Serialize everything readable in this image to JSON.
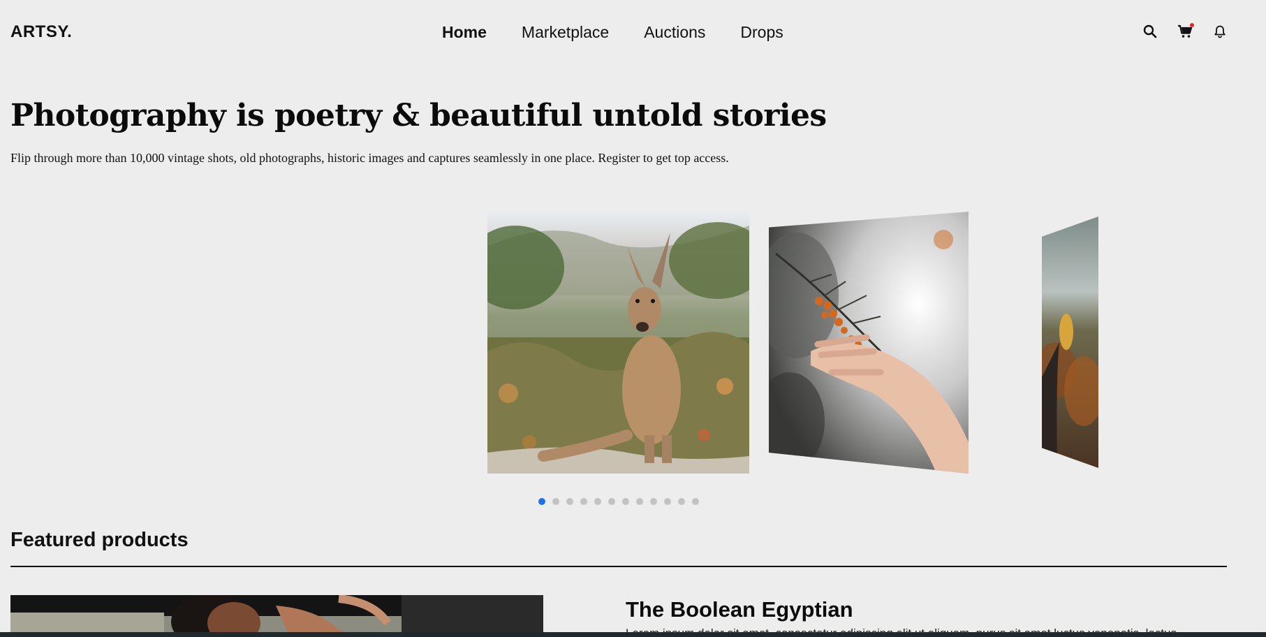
{
  "brand": {
    "logo": "ARTSY."
  },
  "nav": {
    "items": [
      {
        "label": "Home",
        "active": true
      },
      {
        "label": "Marketplace",
        "active": false
      },
      {
        "label": "Auctions",
        "active": false
      },
      {
        "label": "Drops",
        "active": false
      }
    ]
  },
  "header_icons": [
    {
      "name": "search-icon"
    },
    {
      "name": "cart-icon",
      "has_notification_dot": true
    },
    {
      "name": "bell-icon"
    }
  ],
  "hero": {
    "title": "Photography is poetry & beautiful untold stories",
    "subtitle": "Flip through more than 10,000 vintage shots, old photographs, historic images and captures seamlessly in one place. Register to get top access."
  },
  "carousel": {
    "slides": [
      {
        "name": "kangaroo-photo"
      },
      {
        "name": "hand-branch-photo"
      },
      {
        "name": "autumn-leaf-photo"
      }
    ],
    "dot_count": 12,
    "active_dot": 0
  },
  "featured": {
    "section_title": "Featured products",
    "product": {
      "title": "The Boolean Egyptian",
      "description": "Lorem ipsum dolor sit amet, consectetur adipiscing elit ut aliquam, purus sit amet luctus venenatis, lectus"
    }
  },
  "colors": {
    "background": "#ededed",
    "accent": "#1a73e8",
    "notification": "#e02525",
    "text": "#111111"
  }
}
